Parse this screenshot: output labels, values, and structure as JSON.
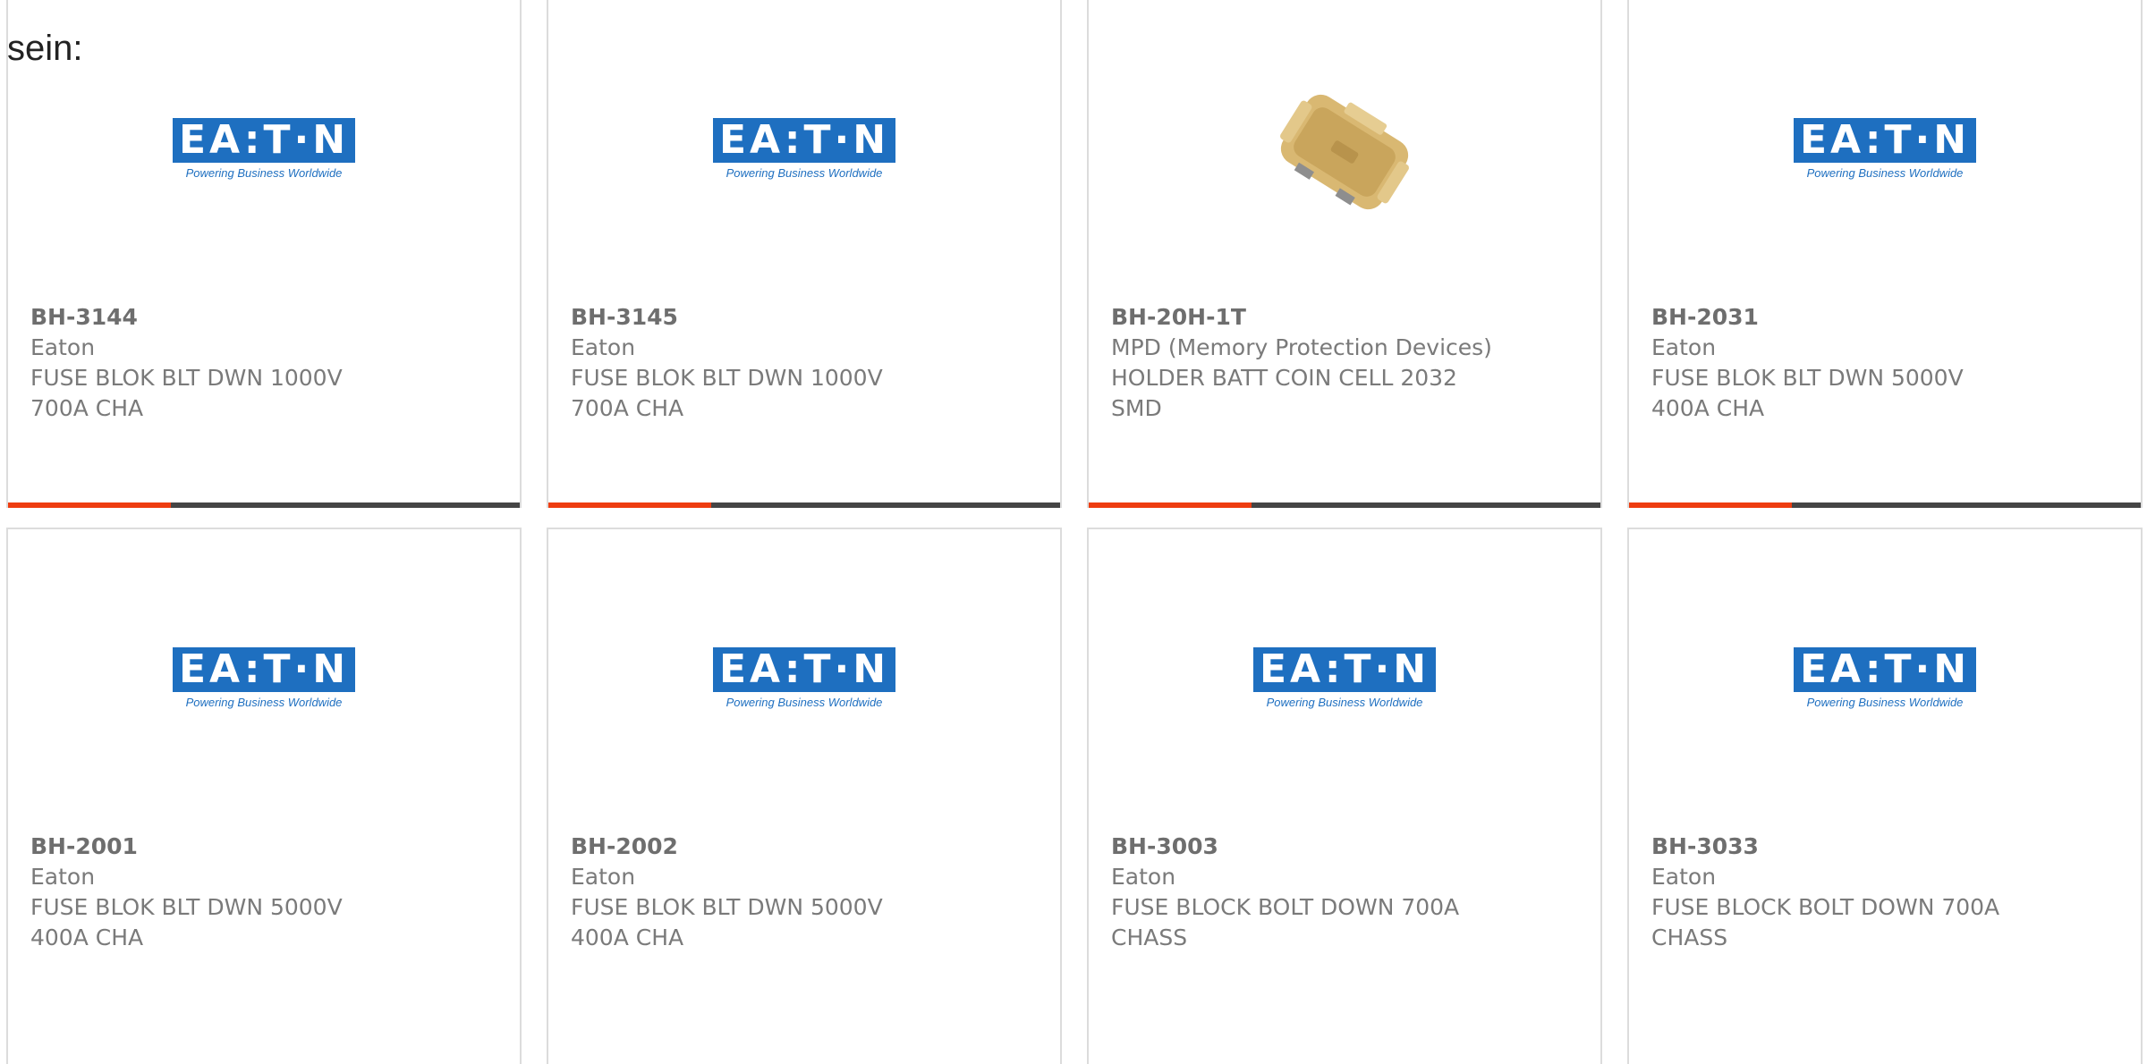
{
  "lead_text": "sein:",
  "logo": {
    "word": "EA:T·N",
    "tagline": "Powering Business Worldwide",
    "brand_color": "#1e6fc0"
  },
  "colors": {
    "accent": "#ee3d10",
    "bar": "#454545"
  },
  "products": [
    {
      "part": "BH-3144",
      "maker": "Eaton",
      "desc1": "FUSE BLOK BLT DWN 1000V",
      "desc2": "700A CHA",
      "image": "eaton-logo"
    },
    {
      "part": "BH-3145",
      "maker": "Eaton",
      "desc1": "FUSE BLOK BLT DWN 1000V",
      "desc2": "700A CHA",
      "image": "eaton-logo"
    },
    {
      "part": "BH-20H-1T",
      "maker": "MPD (Memory Protection Devices)",
      "desc1": "HOLDER BATT COIN CELL 2032",
      "desc2": "SMD",
      "image": "coin-cell-holder"
    },
    {
      "part": "BH-2031",
      "maker": "Eaton",
      "desc1": "FUSE BLOK BLT DWN 5000V",
      "desc2": "400A CHA",
      "image": "eaton-logo"
    },
    {
      "part": "BH-2001",
      "maker": "Eaton",
      "desc1": "FUSE BLOK BLT DWN 5000V",
      "desc2": "400A CHA",
      "image": "eaton-logo"
    },
    {
      "part": "BH-2002",
      "maker": "Eaton",
      "desc1": "FUSE BLOK BLT DWN 5000V",
      "desc2": "400A CHA",
      "image": "eaton-logo"
    },
    {
      "part": "BH-3003",
      "maker": "Eaton",
      "desc1": "FUSE BLOCK BOLT DOWN 700A",
      "desc2": "CHASS",
      "image": "eaton-logo"
    },
    {
      "part": "BH-3033",
      "maker": "Eaton",
      "desc1": "FUSE BLOCK BOLT DOWN 700A",
      "desc2": "CHASS",
      "image": "eaton-logo"
    }
  ]
}
